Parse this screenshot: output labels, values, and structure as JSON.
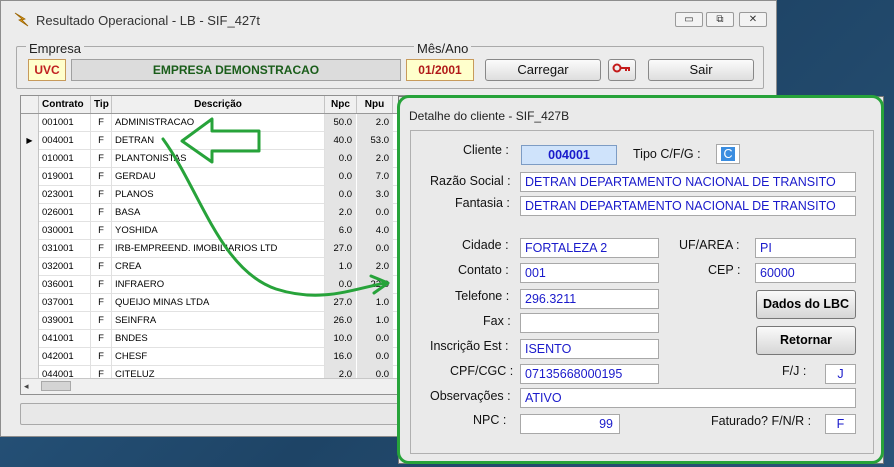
{
  "window": {
    "title": "Resultado Operacional - LB - SIF_427t",
    "minimize_label": "▭",
    "maximize_label": "⧉",
    "close_label": "✕"
  },
  "header": {
    "empresa_label": "Empresa",
    "empresa_code": "UVC",
    "empresa_name": "EMPRESA DEMONSTRACAO",
    "mesano_label": "Mês/Ano",
    "mesano_value": "01/2001",
    "carregar_label": "Carregar",
    "sair_label": "Sair"
  },
  "grid": {
    "columns": [
      "Contrato",
      "Tip",
      "Descrição",
      "Npc",
      "Npu"
    ],
    "rows": [
      {
        "contrato": "001001",
        "tip": "F",
        "descricao": "ADMINISTRACAO",
        "npc": "50.0",
        "npu": "2.0"
      },
      {
        "contrato": "004001",
        "tip": "F",
        "descricao": "DETRAN",
        "npc": "40.0",
        "npu": "53.0"
      },
      {
        "contrato": "010001",
        "tip": "F",
        "descricao": "PLANTONISTAS",
        "npc": "0.0",
        "npu": "2.0"
      },
      {
        "contrato": "019001",
        "tip": "F",
        "descricao": "GERDAU",
        "npc": "0.0",
        "npu": "7.0"
      },
      {
        "contrato": "023001",
        "tip": "F",
        "descricao": "PLANOS",
        "npc": "0.0",
        "npu": "3.0"
      },
      {
        "contrato": "026001",
        "tip": "F",
        "descricao": "BASA",
        "npc": "2.0",
        "npu": "0.0"
      },
      {
        "contrato": "030001",
        "tip": "F",
        "descricao": "YOSHIDA",
        "npc": "6.0",
        "npu": "4.0"
      },
      {
        "contrato": "031001",
        "tip": "F",
        "descricao": "IRB-EMPREEND. IMOBILIARIOS LTD",
        "npc": "27.0",
        "npu": "0.0"
      },
      {
        "contrato": "032001",
        "tip": "F",
        "descricao": "CREA",
        "npc": "1.0",
        "npu": "2.0"
      },
      {
        "contrato": "036001",
        "tip": "F",
        "descricao": "INFRAERO",
        "npc": "0.0",
        "npu": "22.0"
      },
      {
        "contrato": "037001",
        "tip": "F",
        "descricao": "QUEIJO MINAS LTDA",
        "npc": "27.0",
        "npu": "1.0"
      },
      {
        "contrato": "039001",
        "tip": "F",
        "descricao": "SEINFRA",
        "npc": "26.0",
        "npu": "1.0"
      },
      {
        "contrato": "041001",
        "tip": "F",
        "descricao": "BNDES",
        "npc": "10.0",
        "npu": "0.0"
      },
      {
        "contrato": "042001",
        "tip": "F",
        "descricao": "CHESF",
        "npc": "16.0",
        "npu": "0.0"
      },
      {
        "contrato": "044001",
        "tip": "F",
        "descricao": "CITELUZ",
        "npc": "2.0",
        "npu": "0.0"
      }
    ],
    "selected_row_index": 1
  },
  "dialog": {
    "title": "Detalhe do cliente - SIF_427B",
    "cliente_label": "Cliente :",
    "cliente_value": "004001",
    "tipo_label": "Tipo C/F/G :",
    "tipo_value": "C",
    "razao_label": "Razão Social :",
    "razao_value": "DETRAN DEPARTAMENTO NACIONAL DE TRANSITO",
    "fantasia_label": "Fantasia :",
    "fantasia_value": "DETRAN DEPARTAMENTO NACIONAL DE TRANSITO",
    "cidade_label": "Cidade :",
    "cidade_value": "FORTALEZA 2",
    "uf_label": "UF/AREA :",
    "uf_value": "PI",
    "contato_label": "Contato :",
    "contato_value": "001",
    "cep_label": "CEP :",
    "cep_value": "60000",
    "telefone_label": "Telefone :",
    "telefone_value": "296.3211",
    "fax_label": "Fax :",
    "fax_value": "",
    "inscricao_label": "Inscrição Est :",
    "inscricao_value": "ISENTO",
    "cpf_label": "CPF/CGC :",
    "cpf_value": "07135668000195",
    "fj_label": "F/J :",
    "fj_value": "J",
    "obs_label": "Observações :",
    "obs_value": "ATIVO",
    "npc_label": "NPC :",
    "npc_value": "99",
    "faturado_label": "Faturado? F/N/R :",
    "faturado_value": "F",
    "dados_lbc_label": "Dados do LBC",
    "retornar_label": "Retornar"
  },
  "colors": {
    "accent_green": "#27a33a",
    "field_text": "#1a1acb",
    "highlight_yellow": "#ffffcc"
  }
}
